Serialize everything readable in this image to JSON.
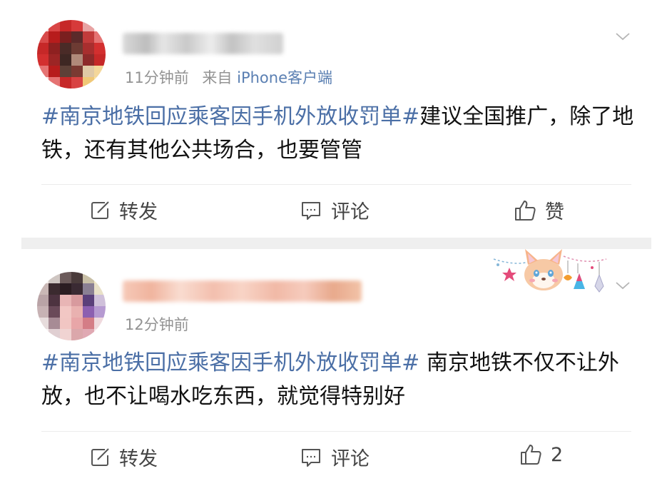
{
  "posts": [
    {
      "time": "11分钟前",
      "source_prefix": "来自",
      "source": "iPhone客户端",
      "topic": "#南京地铁回应乘客因手机外放收罚单#",
      "text": "建议全国推广，除了地铁，还有其他公共场合，也要管管",
      "actions": {
        "repost": "转发",
        "comment": "评论",
        "like": "赞"
      }
    },
    {
      "time": "12分钟前",
      "topic": "#南京地铁回应乘客因手机外放收罚单#",
      "text": " 南京地铁不仅不让外放，也不让喝水吃东西，就觉得特别好",
      "actions": {
        "repost": "转发",
        "comment": "评论",
        "like": "2"
      }
    }
  ],
  "icons": {
    "repost": "edit-box-icon",
    "comment": "comment-bubble-icon",
    "like": "thumbs-up-icon",
    "menu": "chevron-down-icon"
  },
  "colors": {
    "topic_link": "#4b6fa6",
    "meta_text": "#939393",
    "source_link": "#5a7fb2",
    "separator": "#efefef"
  }
}
